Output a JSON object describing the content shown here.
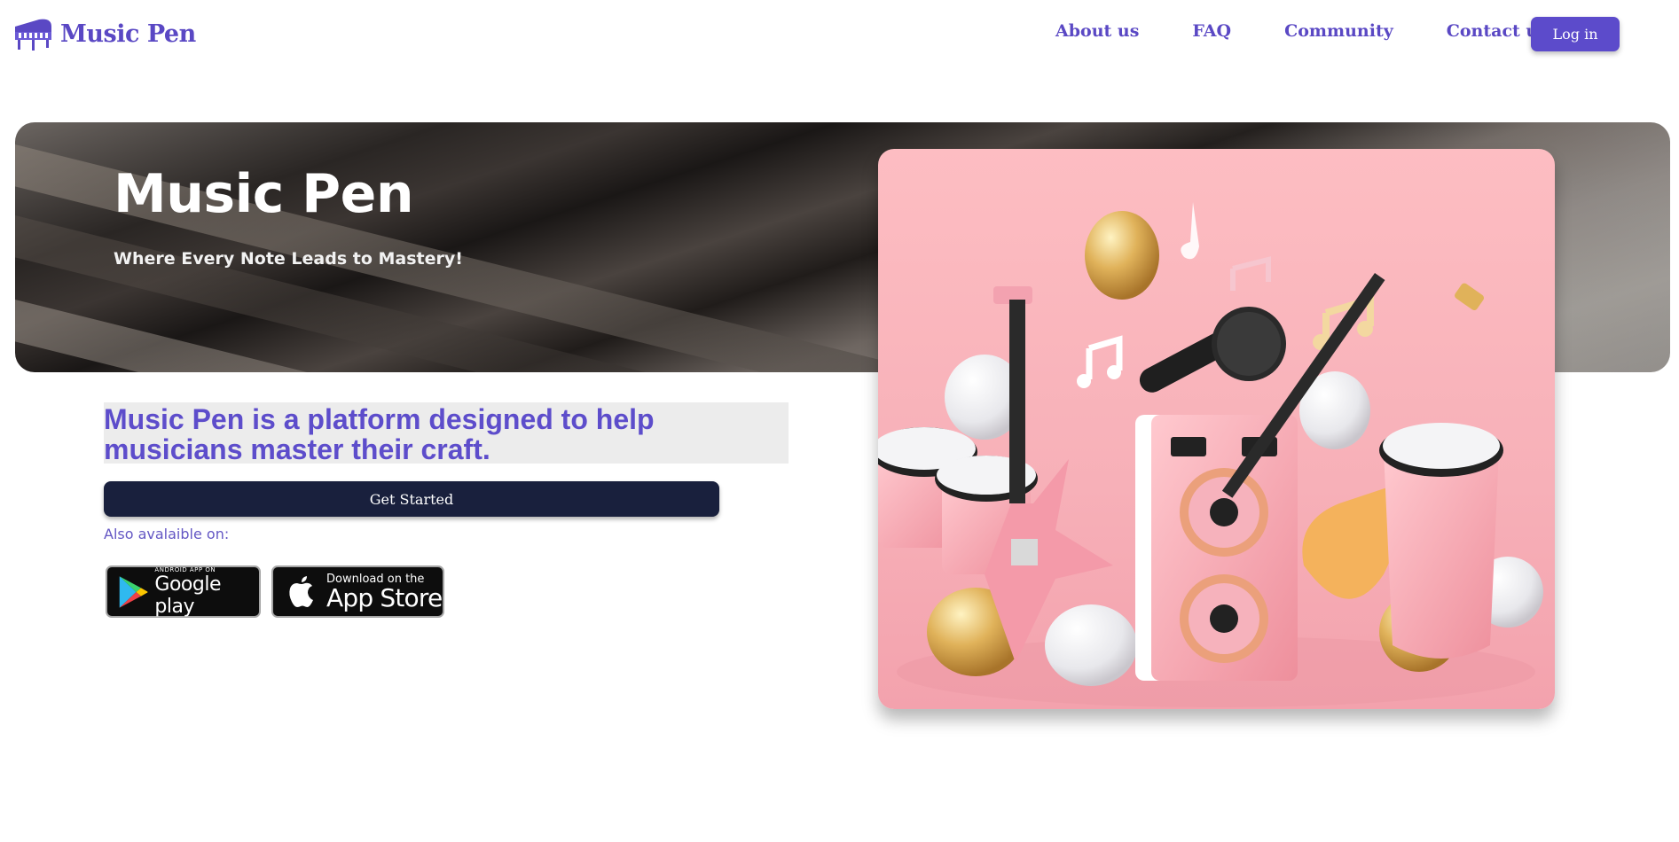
{
  "brand": {
    "name": "Music Pen",
    "icon": "piano-icon"
  },
  "nav": {
    "links": [
      "About us",
      "FAQ",
      "Community",
      "Contact us"
    ],
    "login_label": "Log in"
  },
  "hero": {
    "title": "Music Pen",
    "tagline": "Where Every Note Leads to Mastery!"
  },
  "main": {
    "description": "Music Pen is a platform designed to help musicians master their craft.",
    "cta_label": "Get Started",
    "also_available": "Also avalaible on:",
    "google_play": {
      "small": "ANDROID APP ON",
      "big": "Google play"
    },
    "app_store": {
      "small": "Download on the",
      "big": "App Store"
    }
  },
  "colors": {
    "brand_purple": "#5a48c4",
    "button_dark": "#19203d",
    "illustration_pink": "#fdbdc2"
  }
}
